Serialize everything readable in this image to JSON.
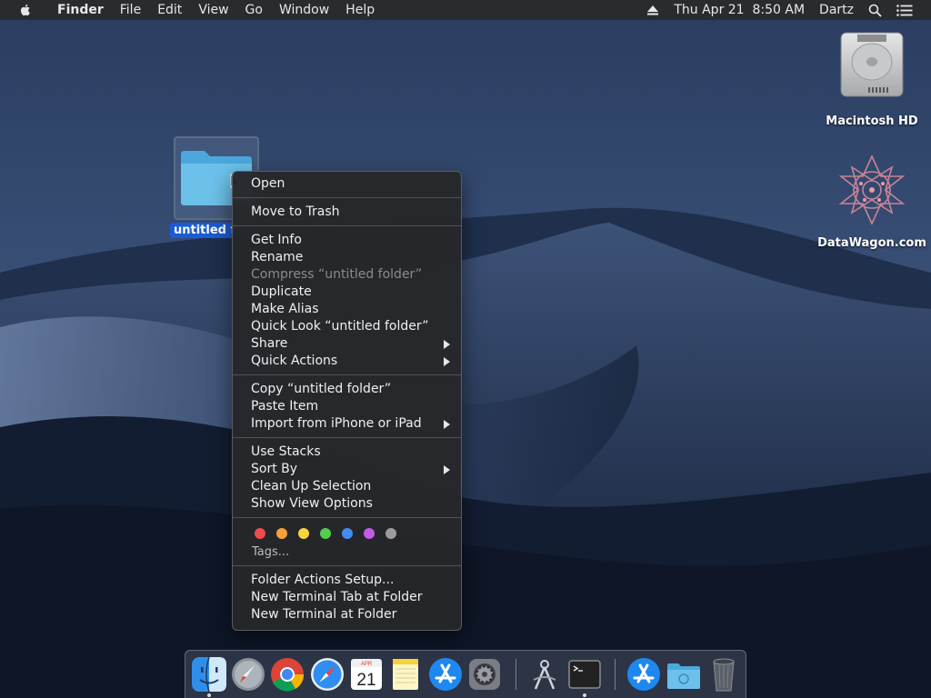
{
  "menubar": {
    "app_name": "Finder",
    "menus": [
      "File",
      "Edit",
      "View",
      "Go",
      "Window",
      "Help"
    ],
    "datetime": "Thu Apr 21  8:50 AM",
    "user": "Dartz"
  },
  "desktop": {
    "icons": [
      {
        "label": "Macintosh HD",
        "icon": "hard-drive-icon"
      },
      {
        "label": "DataWagon.com",
        "icon": "datawagon-logo-icon"
      }
    ],
    "selected_folder": {
      "label": "untitled folder",
      "icon": "folder-icon"
    }
  },
  "context_menu": {
    "open": "Open",
    "move_to_trash": "Move to Trash",
    "get_info": "Get Info",
    "rename": "Rename",
    "compress": "Compress “untitled folder”",
    "duplicate": "Duplicate",
    "make_alias": "Make Alias",
    "quick_look": "Quick Look “untitled folder”",
    "share": "Share",
    "quick_actions": "Quick Actions",
    "copy": "Copy “untitled folder”",
    "paste_item": "Paste Item",
    "import_iphone": "Import from iPhone or iPad",
    "use_stacks": "Use Stacks",
    "sort_by": "Sort By",
    "clean_up": "Clean Up Selection",
    "show_view_options": "Show View Options",
    "tag_colors": [
      "#ee4b4b",
      "#f3a33a",
      "#f5d53a",
      "#55cc4a",
      "#3f8ef0",
      "#c45ae6",
      "#9c9c9f"
    ],
    "tags": "Tags...",
    "folder_actions": "Folder Actions Setup...",
    "new_terminal_tab": "New Terminal Tab at Folder",
    "new_terminal": "New Terminal at Folder"
  },
  "dock": {
    "apps": [
      "finder-icon",
      "launchpad-icon",
      "chrome-icon",
      "safari-icon",
      "calendar-icon",
      "notes-icon",
      "app-store-icon",
      "system-preferences-icon",
      "instruments-icon",
      "terminal-icon",
      "app-store-downloads-icon",
      "folder-stack-icon",
      "trash-icon"
    ],
    "calendar_month": "APR",
    "calendar_day": "21"
  },
  "colors": {
    "menu_bg": "#26272a",
    "selection_blue": "#1a5bd6"
  }
}
